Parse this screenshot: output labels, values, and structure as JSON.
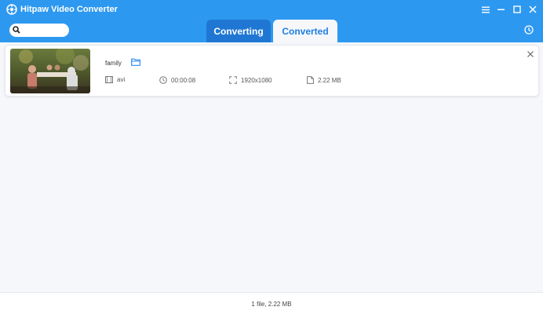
{
  "window": {
    "title": "Hitpaw Video Converter"
  },
  "tabs": {
    "converting": "Converting",
    "converted": "Converted"
  },
  "colors": {
    "header": "#2d98f0",
    "active_tab_text": "#1f7fe0",
    "inactive_tab_bg": "#1f77d3"
  },
  "icons": [
    "app-logo-icon",
    "menu-icon",
    "minimize-icon",
    "maximize-icon",
    "close-icon",
    "search-icon",
    "history-icon",
    "folder-icon",
    "format-icon",
    "duration-icon",
    "resolution-icon",
    "filesize-icon",
    "remove-icon"
  ],
  "file": {
    "name": "family",
    "format": "avi",
    "duration": "00:00:08",
    "resolution": "1920x1080",
    "size": "2.22 MB"
  },
  "footer": {
    "summary": "1 file, 2.22 MB"
  }
}
